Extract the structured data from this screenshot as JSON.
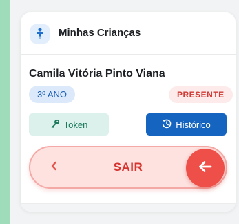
{
  "header": {
    "title": "Minhas Crianças",
    "icon": "child-icon"
  },
  "child": {
    "name": "Camila Vitória Pinto Viana",
    "grade": "3º ANO",
    "status": "PRESENTE"
  },
  "actions": {
    "token_label": "Token",
    "token_icon": "key-icon",
    "history_label": "Histórico",
    "history_icon": "history-icon"
  },
  "exit_slider": {
    "label": "SAIR",
    "chevron_icon": "chevron-left-icon",
    "knob_icon": "arrow-left-icon"
  },
  "colors": {
    "page_background": "#9fdcb9",
    "primary_blue": "#1565c0",
    "danger_red": "#ee4f48",
    "token_green": "#1c7a5a"
  }
}
